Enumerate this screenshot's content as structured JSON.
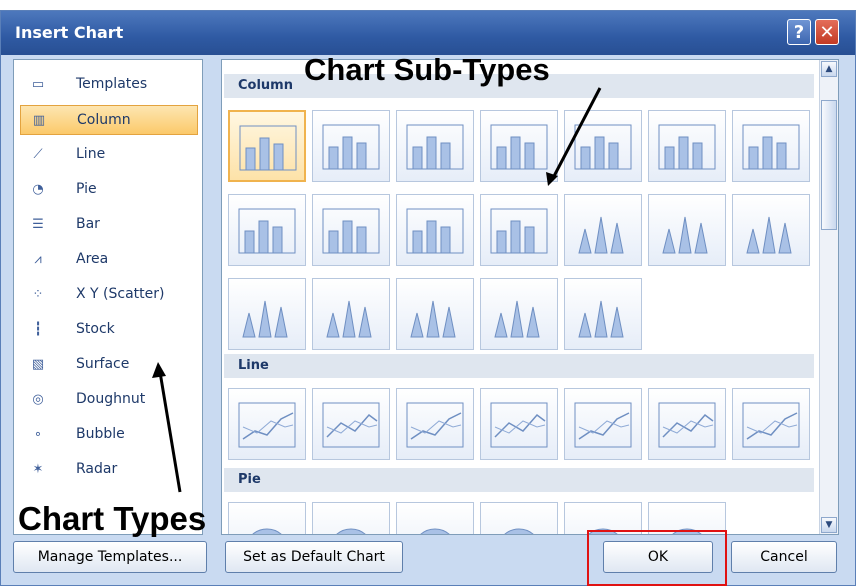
{
  "dialog": {
    "title": "Insert Chart",
    "help_glyph": "?",
    "close_glyph": "✕"
  },
  "chart_types": [
    {
      "label": "Templates",
      "icon": "folder-icon",
      "glyph": "▭",
      "selected": false
    },
    {
      "label": "Column",
      "icon": "column-chart-icon",
      "glyph": "▥",
      "selected": true
    },
    {
      "label": "Line",
      "icon": "line-chart-icon",
      "glyph": "⟋",
      "selected": false
    },
    {
      "label": "Pie",
      "icon": "pie-chart-icon",
      "glyph": "◔",
      "selected": false
    },
    {
      "label": "Bar",
      "icon": "bar-chart-icon",
      "glyph": "☰",
      "selected": false
    },
    {
      "label": "Area",
      "icon": "area-chart-icon",
      "glyph": "⩘",
      "selected": false
    },
    {
      "label": "X Y (Scatter)",
      "icon": "scatter-chart-icon",
      "glyph": "⁘",
      "selected": false
    },
    {
      "label": "Stock",
      "icon": "stock-chart-icon",
      "glyph": "┇",
      "selected": false
    },
    {
      "label": "Surface",
      "icon": "surface-chart-icon",
      "glyph": "▧",
      "selected": false
    },
    {
      "label": "Doughnut",
      "icon": "doughnut-chart-icon",
      "glyph": "◎",
      "selected": false
    },
    {
      "label": "Bubble",
      "icon": "bubble-chart-icon",
      "glyph": "∘",
      "selected": false
    },
    {
      "label": "Radar",
      "icon": "radar-chart-icon",
      "glyph": "✶",
      "selected": false
    }
  ],
  "sections": {
    "column": "Column",
    "line": "Line",
    "pie": "Pie"
  },
  "buttons": {
    "manage_templates": "Manage Templates...",
    "set_default": "Set as Default Chart",
    "ok": "OK",
    "cancel": "Cancel"
  },
  "annotations": {
    "subtypes": "Chart Sub-Types",
    "types": "Chart Types"
  },
  "scroll": {
    "up_glyph": "▲",
    "down_glyph": "▼"
  },
  "colors": {
    "accent": "#2f5aa3",
    "selection": "#fbc96a",
    "highlight_box": "#e01212"
  }
}
